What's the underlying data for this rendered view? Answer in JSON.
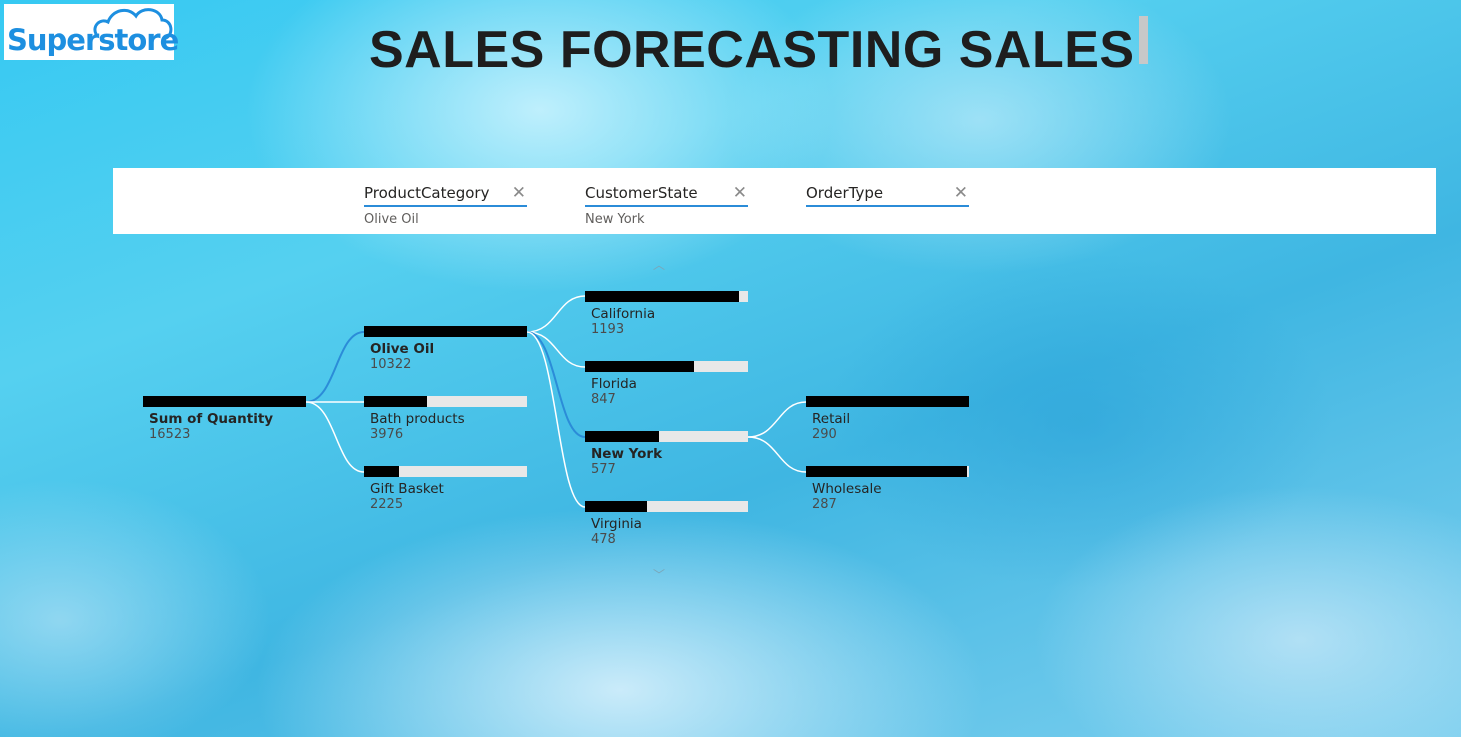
{
  "logo": {
    "text": "Superstore"
  },
  "title": "SALES FORECASTING SALES",
  "levels": [
    {
      "name": "ProductCategory",
      "value": "Olive Oil"
    },
    {
      "name": "CustomerState",
      "value": "New York"
    },
    {
      "name": "OrderType",
      "value": ""
    }
  ],
  "colors": {
    "bar_fill": "#000000",
    "bar_track": "#e8e8e8",
    "selected_link": "#2b8cd8",
    "link": "#ffffff",
    "header_underline": "#2b8cd8"
  },
  "icons": {
    "clear": "close-icon",
    "scroll_up": "chevron-up-icon",
    "scroll_down": "chevron-down-icon"
  },
  "root": {
    "label": "Sum of Quantity",
    "value": "16523",
    "fraction": 1.0
  },
  "product_categories": [
    {
      "label": "Olive Oil",
      "value": "10322",
      "fraction": 1.0,
      "selected": true
    },
    {
      "label": "Bath products",
      "value": "3976",
      "fraction": 0.385
    },
    {
      "label": "Gift Basket",
      "value": "2225",
      "fraction": 0.216
    }
  ],
  "customer_states": [
    {
      "label": "California",
      "value": "1193",
      "fraction": 0.945
    },
    {
      "label": "Florida",
      "value": "847",
      "fraction": 0.671
    },
    {
      "label": "New York",
      "value": "577",
      "fraction": 0.457,
      "selected": true
    },
    {
      "label": "Virginia",
      "value": "478",
      "fraction": 0.379
    }
  ],
  "order_types": [
    {
      "label": "Retail",
      "value": "290",
      "fraction": 1.0
    },
    {
      "label": "Wholesale",
      "value": "287",
      "fraction": 0.99
    }
  ]
}
